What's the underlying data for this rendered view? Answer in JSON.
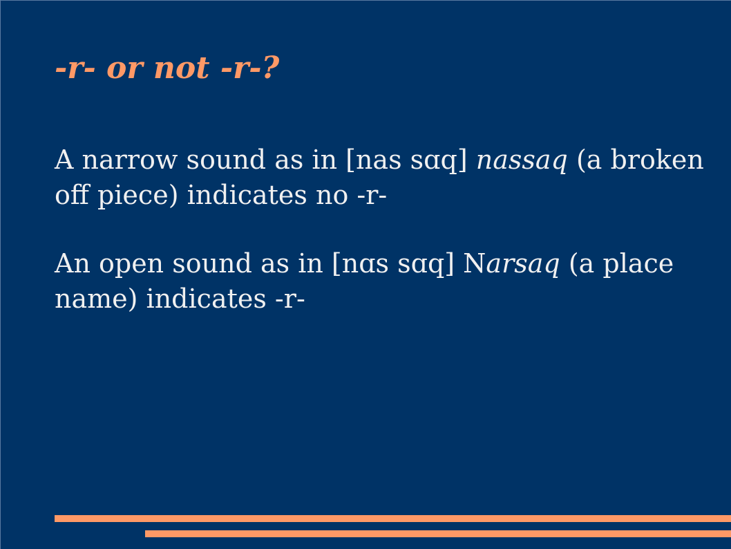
{
  "slide": {
    "title": "-r- or not -r-?",
    "paragraphs": [
      {
        "before": "A narrow sound as in [nas sɑq] ",
        "italic": "nassaq",
        "after": " (a broken off piece) indicates no -r-"
      },
      {
        "before": "An open sound as in [nɑs sɑq] N",
        "italic": "arsaq",
        "after": " (a place name) indicates -r-"
      }
    ]
  },
  "colors": {
    "background": "#003366",
    "title": "#ff9966",
    "text": "#f0f0f0",
    "rules": "#ff9966"
  }
}
